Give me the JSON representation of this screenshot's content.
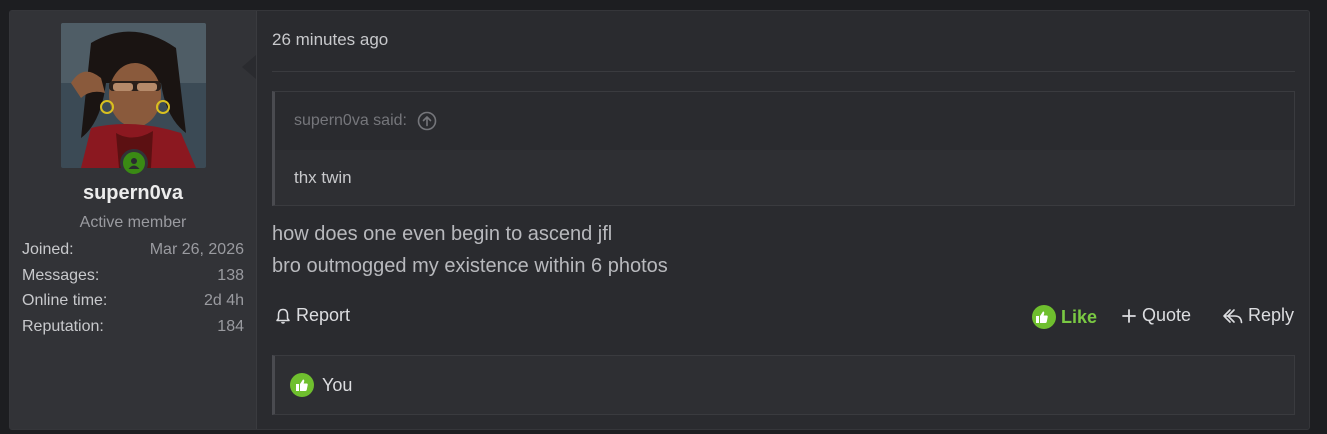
{
  "user": {
    "username": "supern0va",
    "title": "Active member",
    "stats": [
      {
        "label": "Joined:",
        "value": "Mar 26, 2026"
      },
      {
        "label": "Messages:",
        "value": "138"
      },
      {
        "label": "Online time:",
        "value": "2d 4h"
      },
      {
        "label": "Reputation:",
        "value": "184"
      }
    ]
  },
  "post": {
    "timestamp": "26 minutes ago",
    "quote": {
      "author_said": "supern0va said:",
      "text": "thx twin"
    },
    "message_lines": [
      "how does one even begin to ascend jfl",
      "bro outmogged my existence within 6 photos"
    ],
    "actions": {
      "report": "Report",
      "like": "Like",
      "quote": "Quote",
      "reply": "Reply"
    },
    "likes_summary": "You"
  },
  "colors": {
    "accent_like": "#7ac943",
    "online": "#3a8a14",
    "background": "#2a2b2f",
    "user_panel": "#323337"
  },
  "icons": [
    "online-status-icon",
    "jump-to-quote-icon",
    "bell-icon",
    "thumbs-up-icon",
    "plus-icon",
    "reply-icon"
  ]
}
